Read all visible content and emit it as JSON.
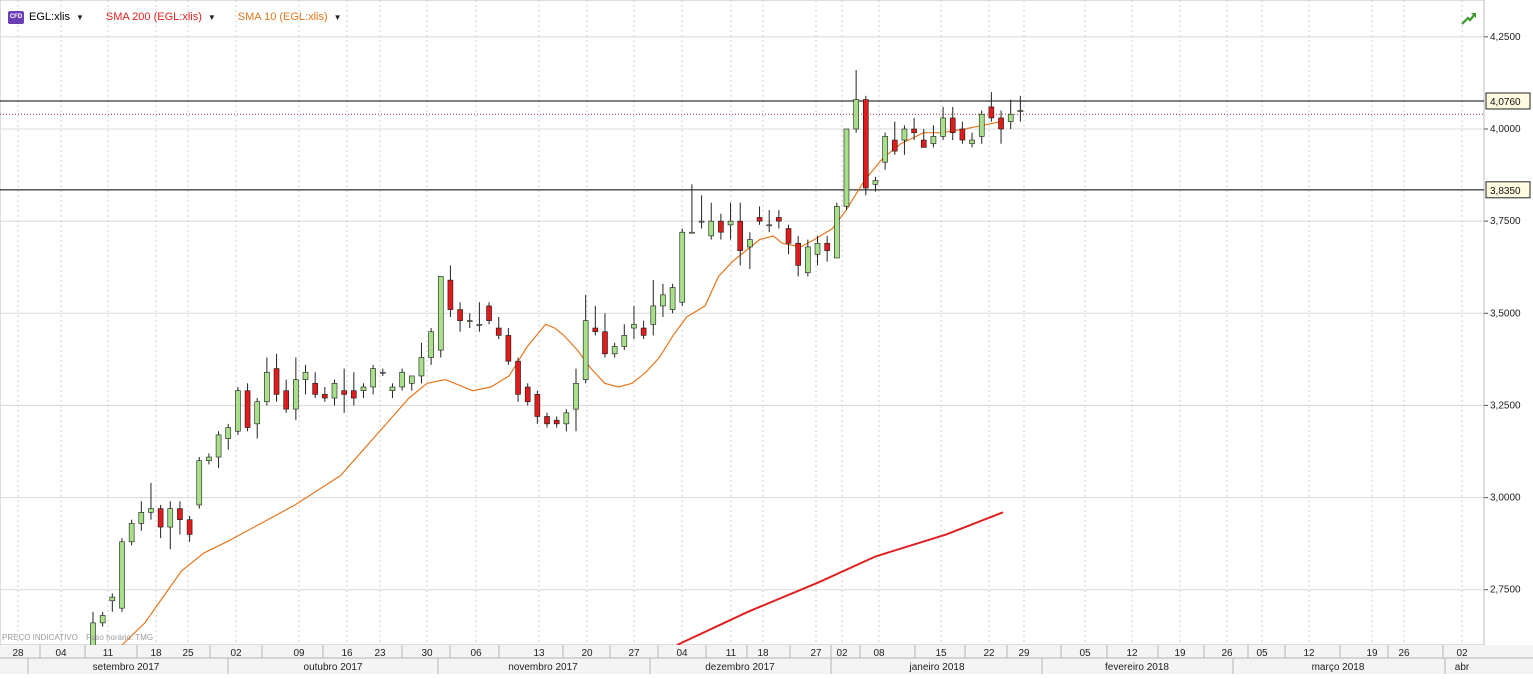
{
  "header": {
    "instrument": {
      "label": "EGL:xlis",
      "badge": "CFD",
      "color": "#111111"
    },
    "indicators": [
      {
        "label": "SMA 200 (EGL:xlis)",
        "color": "#e02020"
      },
      {
        "label": "SMA 10 (EGL:xlis)",
        "color": "#e6771e"
      }
    ]
  },
  "footnote": {
    "price_note": "PREÇO INDICATIVO",
    "timezone_note": "Fuso horário: TMG"
  },
  "price_tags": [
    {
      "value": "4,0760"
    },
    {
      "value": "3,8350"
    }
  ],
  "colors": {
    "up": "#a8e08a",
    "down": "#e01b1b",
    "wick": "#222222",
    "sma10": "#e6771e",
    "sma200": "#e02020",
    "grid": "#d8d8d8",
    "hline": "#000000",
    "dotted": "#a03030"
  },
  "chart_data": {
    "type": "candlestick",
    "ylim": [
      2.6,
      4.35
    ],
    "y_ticks": [
      "2,7500",
      "3,0000",
      "3,2500",
      "3,5000",
      "3,7500",
      "4,0000",
      "4,2500"
    ],
    "x_ticks_days": [
      "28",
      "04",
      "11",
      "18",
      "25",
      "02",
      "09",
      "16",
      "23",
      "30",
      "06",
      "13",
      "20",
      "27",
      "04",
      "11",
      "18",
      "27",
      "02",
      "08",
      "15",
      "22",
      "29",
      "05",
      "12",
      "19",
      "26",
      "05",
      "12",
      "19",
      "26",
      "02"
    ],
    "x_ticks_months": [
      "setembro 2017",
      "outubro 2017",
      "novembro 2017",
      "dezembro 2017",
      "janeiro 2018",
      "fevereiro 2018",
      "março 2018",
      "abr"
    ],
    "horizontal_lines": [
      4.076,
      3.835
    ],
    "dotted_line": 4.04,
    "candles": [
      {
        "o": 2.58,
        "h": 2.69,
        "l": 2.57,
        "c": 2.66
      },
      {
        "o": 2.66,
        "h": 2.69,
        "l": 2.65,
        "c": 2.68
      },
      {
        "o": 2.72,
        "h": 2.74,
        "l": 2.69,
        "c": 2.73
      },
      {
        "o": 2.7,
        "h": 2.89,
        "l": 2.69,
        "c": 2.88
      },
      {
        "o": 2.88,
        "h": 2.94,
        "l": 2.87,
        "c": 2.93
      },
      {
        "o": 2.93,
        "h": 2.99,
        "l": 2.91,
        "c": 2.96
      },
      {
        "o": 2.96,
        "h": 3.04,
        "l": 2.94,
        "c": 2.97
      },
      {
        "o": 2.97,
        "h": 2.98,
        "l": 2.89,
        "c": 2.92
      },
      {
        "o": 2.92,
        "h": 2.99,
        "l": 2.86,
        "c": 2.97
      },
      {
        "o": 2.97,
        "h": 2.99,
        "l": 2.9,
        "c": 2.94
      },
      {
        "o": 2.94,
        "h": 2.95,
        "l": 2.88,
        "c": 2.9
      },
      {
        "o": 2.98,
        "h": 3.11,
        "l": 2.97,
        "c": 3.1
      },
      {
        "o": 3.1,
        "h": 3.12,
        "l": 3.09,
        "c": 3.11
      },
      {
        "o": 3.11,
        "h": 3.18,
        "l": 3.08,
        "c": 3.17
      },
      {
        "o": 3.16,
        "h": 3.2,
        "l": 3.13,
        "c": 3.19
      },
      {
        "o": 3.18,
        "h": 3.3,
        "l": 3.17,
        "c": 3.29
      },
      {
        "o": 3.29,
        "h": 3.31,
        "l": 3.18,
        "c": 3.19
      },
      {
        "o": 3.2,
        "h": 3.27,
        "l": 3.16,
        "c": 3.26
      },
      {
        "o": 3.26,
        "h": 3.38,
        "l": 3.25,
        "c": 3.34
      },
      {
        "o": 3.35,
        "h": 3.39,
        "l": 3.26,
        "c": 3.28
      },
      {
        "o": 3.29,
        "h": 3.32,
        "l": 3.23,
        "c": 3.24
      },
      {
        "o": 3.24,
        "h": 3.38,
        "l": 3.21,
        "c": 3.32
      },
      {
        "o": 3.32,
        "h": 3.36,
        "l": 3.28,
        "c": 3.34
      },
      {
        "o": 3.31,
        "h": 3.34,
        "l": 3.27,
        "c": 3.28
      },
      {
        "o": 3.28,
        "h": 3.3,
        "l": 3.26,
        "c": 3.27
      },
      {
        "o": 3.27,
        "h": 3.32,
        "l": 3.25,
        "c": 3.31
      },
      {
        "o": 3.29,
        "h": 3.35,
        "l": 3.23,
        "c": 3.28
      },
      {
        "o": 3.29,
        "h": 3.34,
        "l": 3.25,
        "c": 3.27
      },
      {
        "o": 3.29,
        "h": 3.31,
        "l": 3.27,
        "c": 3.3
      },
      {
        "o": 3.3,
        "h": 3.36,
        "l": 3.28,
        "c": 3.35
      },
      {
        "o": 3.34,
        "h": 3.35,
        "l": 3.33,
        "c": 3.34
      },
      {
        "o": 3.29,
        "h": 3.31,
        "l": 3.27,
        "c": 3.3
      },
      {
        "o": 3.3,
        "h": 3.35,
        "l": 3.29,
        "c": 3.34
      },
      {
        "o": 3.31,
        "h": 3.33,
        "l": 3.29,
        "c": 3.33
      },
      {
        "o": 3.33,
        "h": 3.42,
        "l": 3.31,
        "c": 3.38
      },
      {
        "o": 3.38,
        "h": 3.46,
        "l": 3.36,
        "c": 3.45
      },
      {
        "o": 3.4,
        "h": 3.6,
        "l": 3.38,
        "c": 3.6
      },
      {
        "o": 3.59,
        "h": 3.63,
        "l": 3.49,
        "c": 3.51
      },
      {
        "o": 3.51,
        "h": 3.53,
        "l": 3.45,
        "c": 3.48
      },
      {
        "o": 3.48,
        "h": 3.5,
        "l": 3.46,
        "c": 3.48
      },
      {
        "o": 3.47,
        "h": 3.53,
        "l": 3.45,
        "c": 3.47
      },
      {
        "o": 3.52,
        "h": 3.53,
        "l": 3.47,
        "c": 3.48
      },
      {
        "o": 3.46,
        "h": 3.49,
        "l": 3.43,
        "c": 3.44
      },
      {
        "o": 3.44,
        "h": 3.46,
        "l": 3.36,
        "c": 3.37
      },
      {
        "o": 3.37,
        "h": 3.38,
        "l": 3.26,
        "c": 3.28
      },
      {
        "o": 3.3,
        "h": 3.31,
        "l": 3.25,
        "c": 3.26
      },
      {
        "o": 3.28,
        "h": 3.29,
        "l": 3.2,
        "c": 3.22
      },
      {
        "o": 3.22,
        "h": 3.23,
        "l": 3.19,
        "c": 3.2
      },
      {
        "o": 3.21,
        "h": 3.22,
        "l": 3.19,
        "c": 3.2
      },
      {
        "o": 3.2,
        "h": 3.24,
        "l": 3.18,
        "c": 3.23
      },
      {
        "o": 3.24,
        "h": 3.35,
        "l": 3.18,
        "c": 3.31
      },
      {
        "o": 3.32,
        "h": 3.55,
        "l": 3.31,
        "c": 3.48
      },
      {
        "o": 3.46,
        "h": 3.52,
        "l": 3.44,
        "c": 3.45
      },
      {
        "o": 3.45,
        "h": 3.5,
        "l": 3.38,
        "c": 3.39
      },
      {
        "o": 3.39,
        "h": 3.42,
        "l": 3.38,
        "c": 3.41
      },
      {
        "o": 3.41,
        "h": 3.47,
        "l": 3.4,
        "c": 3.44
      },
      {
        "o": 3.46,
        "h": 3.52,
        "l": 3.43,
        "c": 3.47
      },
      {
        "o": 3.46,
        "h": 3.48,
        "l": 3.43,
        "c": 3.44
      },
      {
        "o": 3.47,
        "h": 3.59,
        "l": 3.44,
        "c": 3.52
      },
      {
        "o": 3.52,
        "h": 3.58,
        "l": 3.49,
        "c": 3.55
      },
      {
        "o": 3.51,
        "h": 3.58,
        "l": 3.5,
        "c": 3.57
      },
      {
        "o": 3.53,
        "h": 3.73,
        "l": 3.52,
        "c": 3.72
      },
      {
        "o": 3.72,
        "h": 3.85,
        "l": 3.72,
        "c": 3.72
      },
      {
        "o": 3.75,
        "h": 3.82,
        "l": 3.73,
        "c": 3.75
      },
      {
        "o": 3.71,
        "h": 3.8,
        "l": 3.7,
        "c": 3.75
      },
      {
        "o": 3.75,
        "h": 3.77,
        "l": 3.7,
        "c": 3.72
      },
      {
        "o": 3.74,
        "h": 3.8,
        "l": 3.7,
        "c": 3.75
      },
      {
        "o": 3.75,
        "h": 3.8,
        "l": 3.63,
        "c": 3.67
      },
      {
        "o": 3.68,
        "h": 3.72,
        "l": 3.62,
        "c": 3.7
      },
      {
        "o": 3.76,
        "h": 3.79,
        "l": 3.74,
        "c": 3.75
      },
      {
        "o": 3.74,
        "h": 3.78,
        "l": 3.72,
        "c": 3.74
      },
      {
        "o": 3.76,
        "h": 3.78,
        "l": 3.73,
        "c": 3.75
      },
      {
        "o": 3.73,
        "h": 3.74,
        "l": 3.66,
        "c": 3.69
      },
      {
        "o": 3.69,
        "h": 3.71,
        "l": 3.6,
        "c": 3.63
      },
      {
        "o": 3.61,
        "h": 3.7,
        "l": 3.6,
        "c": 3.68
      },
      {
        "o": 3.66,
        "h": 3.71,
        "l": 3.63,
        "c": 3.69
      },
      {
        "o": 3.69,
        "h": 3.71,
        "l": 3.64,
        "c": 3.67
      },
      {
        "o": 3.65,
        "h": 3.8,
        "l": 3.65,
        "c": 3.79
      },
      {
        "o": 3.79,
        "h": 4.0,
        "l": 3.78,
        "c": 4.0
      },
      {
        "o": 4.0,
        "h": 4.16,
        "l": 3.99,
        "c": 4.08
      },
      {
        "o": 4.08,
        "h": 4.09,
        "l": 3.82,
        "c": 3.84
      },
      {
        "o": 3.85,
        "h": 3.87,
        "l": 3.83,
        "c": 3.86
      },
      {
        "o": 3.91,
        "h": 3.99,
        "l": 3.89,
        "c": 3.98
      },
      {
        "o": 3.97,
        "h": 4.02,
        "l": 3.93,
        "c": 3.94
      },
      {
        "o": 3.97,
        "h": 4.01,
        "l": 3.93,
        "c": 4.0
      },
      {
        "o": 4.0,
        "h": 4.03,
        "l": 3.97,
        "c": 3.99
      },
      {
        "o": 3.97,
        "h": 4.0,
        "l": 3.95,
        "c": 3.95
      },
      {
        "o": 3.96,
        "h": 4.01,
        "l": 3.95,
        "c": 3.98
      },
      {
        "o": 3.98,
        "h": 4.06,
        "l": 3.97,
        "c": 4.03
      },
      {
        "o": 4.03,
        "h": 4.06,
        "l": 3.97,
        "c": 3.99
      },
      {
        "o": 4.0,
        "h": 4.02,
        "l": 3.96,
        "c": 3.97
      },
      {
        "o": 3.96,
        "h": 3.99,
        "l": 3.95,
        "c": 3.97
      },
      {
        "o": 3.98,
        "h": 4.05,
        "l": 3.96,
        "c": 4.04
      },
      {
        "o": 4.06,
        "h": 4.1,
        "l": 4.02,
        "c": 4.03
      },
      {
        "o": 4.03,
        "h": 4.05,
        "l": 3.96,
        "c": 4.0
      },
      {
        "o": 4.02,
        "h": 4.08,
        "l": 4.0,
        "c": 4.04
      },
      {
        "o": 4.05,
        "h": 4.09,
        "l": 4.02,
        "c": 4.05
      }
    ],
    "sma10": [
      [
        2.57,
        2.6
      ],
      [
        2.62,
        2.66
      ],
      [
        2.66,
        2.73
      ],
      [
        2.7,
        2.8
      ],
      [
        2.75,
        2.85
      ],
      [
        2.8,
        2.88
      ],
      [
        2.86,
        2.92
      ],
      [
        2.95,
        2.98
      ],
      [
        3.05,
        3.06
      ],
      [
        3.1,
        3.13
      ],
      [
        3.15,
        3.2
      ],
      [
        3.2,
        3.27
      ],
      [
        3.24,
        3.31
      ],
      [
        3.28,
        3.32
      ],
      [
        3.3,
        3.31
      ],
      [
        3.34,
        3.29
      ],
      [
        3.38,
        3.3
      ],
      [
        3.42,
        3.33
      ],
      [
        3.46,
        3.41
      ],
      [
        3.48,
        3.44
      ],
      [
        3.5,
        3.47
      ],
      [
        3.52,
        3.46
      ],
      [
        3.54,
        3.44
      ],
      [
        3.57,
        3.4
      ],
      [
        3.6,
        3.35
      ],
      [
        3.63,
        3.31
      ],
      [
        3.66,
        3.3
      ],
      [
        3.69,
        3.31
      ],
      [
        3.72,
        3.34
      ],
      [
        3.75,
        3.38
      ],
      [
        3.78,
        3.44
      ],
      [
        3.81,
        3.49
      ],
      [
        3.85,
        3.52
      ],
      [
        3.88,
        3.6
      ],
      [
        3.91,
        3.64
      ],
      [
        3.94,
        3.67
      ],
      [
        3.97,
        3.7
      ],
      [
        4.0,
        3.71
      ],
      [
        4.02,
        3.69
      ],
      [
        4.06,
        3.68
      ],
      [
        4.09,
        3.7
      ],
      [
        4.13,
        3.73
      ],
      [
        4.16,
        3.78
      ],
      [
        4.2,
        3.86
      ],
      [
        4.24,
        3.92
      ],
      [
        4.28,
        3.96
      ],
      [
        4.33,
        3.99
      ],
      [
        4.37,
        3.99
      ],
      [
        4.42,
        4.0
      ],
      [
        4.46,
        4.01
      ],
      [
        4.5,
        4.02
      ]
    ],
    "sma200": [
      [
        3.55,
        2.6
      ],
      [
        3.8,
        2.69
      ],
      [
        4.05,
        2.77
      ],
      [
        4.25,
        2.84
      ],
      [
        4.5,
        2.9
      ],
      [
        4.7,
        2.96
      ]
    ]
  }
}
